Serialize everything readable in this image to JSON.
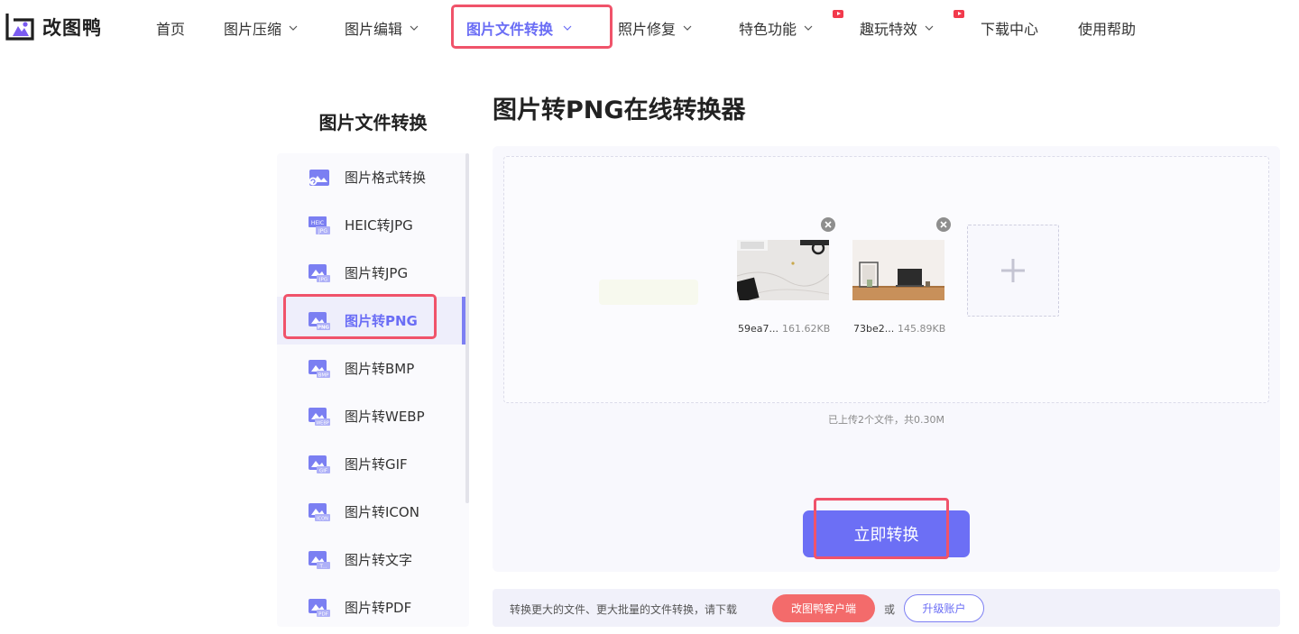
{
  "brand": {
    "name": "改图鸭",
    "logo_icon": "duck-logo-icon"
  },
  "nav": {
    "items": [
      {
        "label": "首页",
        "dropdown": false
      },
      {
        "label": "图片压缩",
        "dropdown": true
      },
      {
        "label": "图片编辑",
        "dropdown": true
      },
      {
        "label": "图片文件转换",
        "dropdown": true,
        "active": true
      },
      {
        "label": "照片修复",
        "dropdown": true
      },
      {
        "label": "特色功能",
        "dropdown": true,
        "badge": "video-badge-icon"
      },
      {
        "label": "趣玩特效",
        "dropdown": true,
        "badge": "video-badge-icon"
      },
      {
        "label": "下载中心",
        "dropdown": false
      },
      {
        "label": "使用帮助",
        "dropdown": false
      }
    ]
  },
  "sidebar": {
    "title": "图片文件转换",
    "items": [
      {
        "label": "图片格式转换",
        "icon_tag": ""
      },
      {
        "label": "HEIC转JPG",
        "icon_tag": "HEIC/JPG"
      },
      {
        "label": "图片转JPG",
        "icon_tag": "JPG"
      },
      {
        "label": "图片转PNG",
        "icon_tag": "PNG",
        "active": true
      },
      {
        "label": "图片转BMP",
        "icon_tag": "BMP"
      },
      {
        "label": "图片转WEBP",
        "icon_tag": "WEBP"
      },
      {
        "label": "图片转GIF",
        "icon_tag": "GIF"
      },
      {
        "label": "图片转ICON",
        "icon_tag": "ICON"
      },
      {
        "label": "图片转文字",
        "icon_tag": "T"
      },
      {
        "label": "图片转PDF",
        "icon_tag": "PDF"
      }
    ]
  },
  "main": {
    "title": "图片转PNG在线转换器",
    "files": [
      {
        "name": "59ea7...",
        "size": "161.62KB"
      },
      {
        "name": "73be2...",
        "size": "145.89KB"
      }
    ],
    "upload_status": "已上传2个文件，共0.30M",
    "convert_label": "立即转换"
  },
  "promo": {
    "text": "转换更大的文件、更大批量的文件转换，请下载",
    "client_label": "改图鸭客户端",
    "or_label": "或",
    "upgrade_label": "升级账户"
  },
  "colors": {
    "accent": "#6c6ff5",
    "highlight_red": "#f0536a",
    "client_button": "#f36b6b"
  }
}
